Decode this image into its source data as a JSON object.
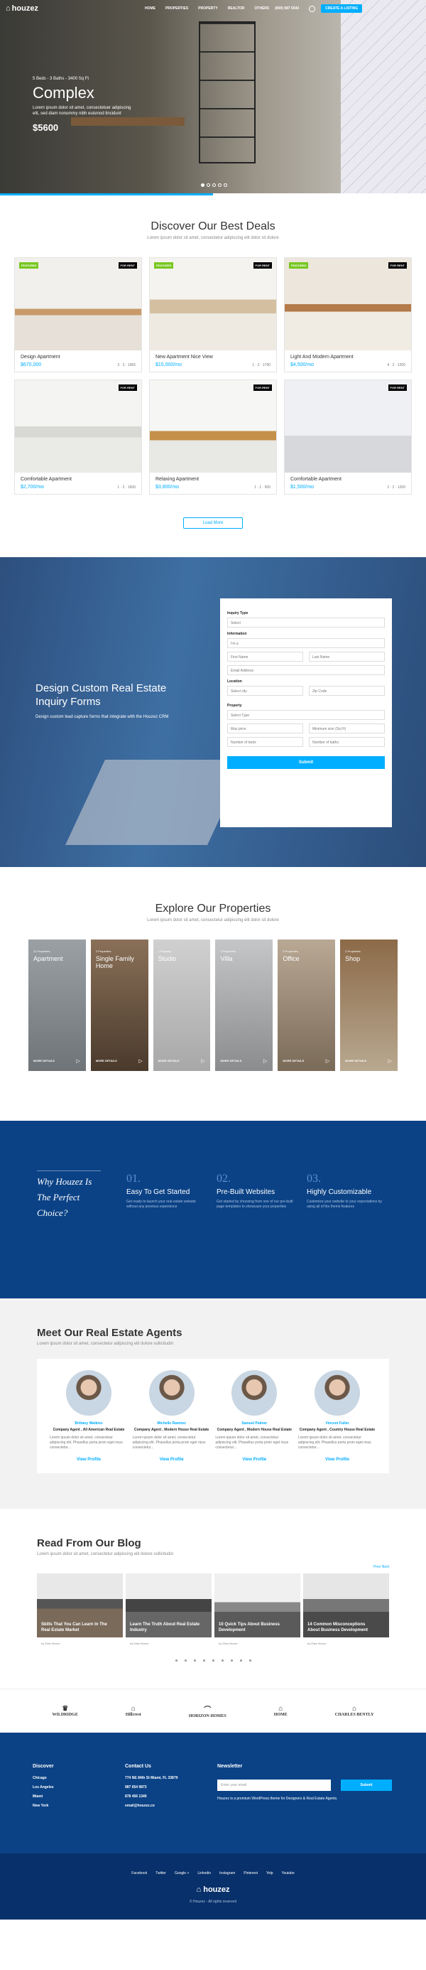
{
  "header": {
    "logo": "houzez",
    "nav": [
      "HOME",
      "PROPERTIES",
      "PROPERTY",
      "REALTOR",
      "OTHERS"
    ],
    "phone": "(800) 987 6543",
    "cta": "CREATE A LISTING"
  },
  "hero": {
    "meta": "5 Beds - 3 Baths - 3400 Sq Ft",
    "title": "Complex",
    "desc": "Lorem ipsum dolor sit amet, consectetuer adipiscing elit, sed diam nonummy nibh euismod tincidunt",
    "price": "$5600"
  },
  "deals": {
    "title": "Discover Our Best Deals",
    "subtitle": "Lorem ipsum dolor sit amet, consectetur adipiscing elit dolor sit dolore",
    "load_more": "Load More",
    "featured_tag": "FEATURED",
    "sale_tag": "FOR RENT",
    "items": [
      {
        "title": "Design Apartment",
        "price": "$670,000",
        "info": "3 · 3 · 1965"
      },
      {
        "title": "New Apartment Nice View",
        "price": "$15,000/mo",
        "info": "1 · 2 · 1790"
      },
      {
        "title": "Light And Modern Apartment",
        "price": "$4,500/mo",
        "info": "4 · 2 · 1200"
      },
      {
        "title": "Comfortable Apartment",
        "price": "$2,700/mo",
        "info": "1 · 2 · 1600"
      },
      {
        "title": "Relaxing Apartment",
        "price": "$3,800/mo",
        "info": "1 · 1 · 900"
      },
      {
        "title": "Comfortable Apartment",
        "price": "$1,500/mo",
        "info": "2 · 2 · 1200"
      }
    ]
  },
  "inquiry": {
    "title": "Design Custom Real Estate Inquiry Forms",
    "desc": "Design custom lead capture forms that integrate with the Houzez CRM",
    "labels": {
      "type": "Inquiry Type",
      "info": "Information",
      "location": "Location",
      "property": "Property"
    },
    "fields": {
      "select": "Select",
      "im_a": "I'm a",
      "first": "First Name",
      "last": "Last Name",
      "email": "Email Address",
      "city": "Select city",
      "zip": "Zip Code",
      "ptype": "Select Type",
      "max_price": "Max price",
      "min_size": "Minimum size (Sq Ft)",
      "beds": "Number of beds",
      "baths": "Number of baths"
    },
    "submit": "Submit"
  },
  "explore": {
    "title": "Explore Our Properties",
    "subtitle": "Lorem ipsum dolor sit amet, consectetur adipiscing elit dolor sit dolore",
    "more": "MORE DETAILS",
    "tiles": [
      {
        "count": "11 Properties",
        "name": "Apartment"
      },
      {
        "count": "2 Properties",
        "name": "Single Family Home"
      },
      {
        "count": "1 Property",
        "name": "Studio"
      },
      {
        "count": "3 Properties",
        "name": "Villa"
      },
      {
        "count": "5 Properties",
        "name": "Office"
      },
      {
        "count": "2 Properties",
        "name": "Shop"
      }
    ]
  },
  "why": {
    "heading": "Why Houzez Is The Perfect Choice?",
    "cols": [
      {
        "num": "01.",
        "title": "Easy To Get Started",
        "desc": "Get ready to launch your real estate website without any previous experience"
      },
      {
        "num": "02.",
        "title": "Pre-Built Websites",
        "desc": "Get started by choosing from one of our pre-built page templates to showcase your properties"
      },
      {
        "num": "03.",
        "title": "Highly Customizable",
        "desc": "Customize your website to your expectations by using all of the theme features"
      }
    ]
  },
  "agents": {
    "title": "Meet Our Real Estate Agents",
    "subtitle": "Lorem ipsum dolor sit amet, consectetur adipiscing elit dolore sollicitudin",
    "link": "View Profile",
    "desc": "Lorem ipsum dolor sit amet, consectetur adipiscing elit. Phasellus porta proin eget risus consectetur...",
    "list": [
      {
        "name": "Brittany Watkins",
        "role": "Company Agent , All American Real Estate"
      },
      {
        "name": "Michelle Ramirez",
        "role": "Company Agent , Modern House Real Estate"
      },
      {
        "name": "Samuel Palmer",
        "role": "Company Agent , Modern House Real Estate"
      },
      {
        "name": "Vincent Fuller",
        "role": "Company Agent , Country House Real Estate"
      }
    ]
  },
  "blog": {
    "title": "Read From Our Blog",
    "subtitle": "Lorem ipsum dolor sit amet, consectetur adipiscing elit dolore sollicitudin",
    "nav": "Prev    Next",
    "author": "by Elise Moore",
    "posts": [
      "Skills That You Can Learn In The Real Estate Market",
      "Learn The Truth About Real Estate Industry",
      "10 Quick Tips About Business Development",
      "14 Common Misconceptions About Business Development"
    ]
  },
  "partners": [
    "WILDRIDGE",
    "Hillcrest",
    "HORIZON HOMES",
    "HOME",
    "CHARLES BENTLY"
  ],
  "footer": {
    "discover": {
      "title": "Discover",
      "items": [
        "Chicago",
        "Los Angeles",
        "Miami",
        "New York"
      ]
    },
    "contact": {
      "title": "Contact Us",
      "items": [
        "774 NE 84th St Miami, FL 33879",
        "987 654 9873",
        "878 456 1349",
        "email@houzez.co"
      ]
    },
    "news": {
      "title": "Newsletter",
      "placeholder": "Enter your email",
      "button": "Submit",
      "text": "Houzez is a premium WordPress theme for Designers & Real Estate Agents."
    },
    "social": [
      "Facebook",
      "Twitter",
      "Google +",
      "Linkedin",
      "Instagram",
      "Pinterest",
      "Yelp",
      "Youtube"
    ],
    "logo": "houzez",
    "copyright": "© Houzez - All rights reserved"
  }
}
